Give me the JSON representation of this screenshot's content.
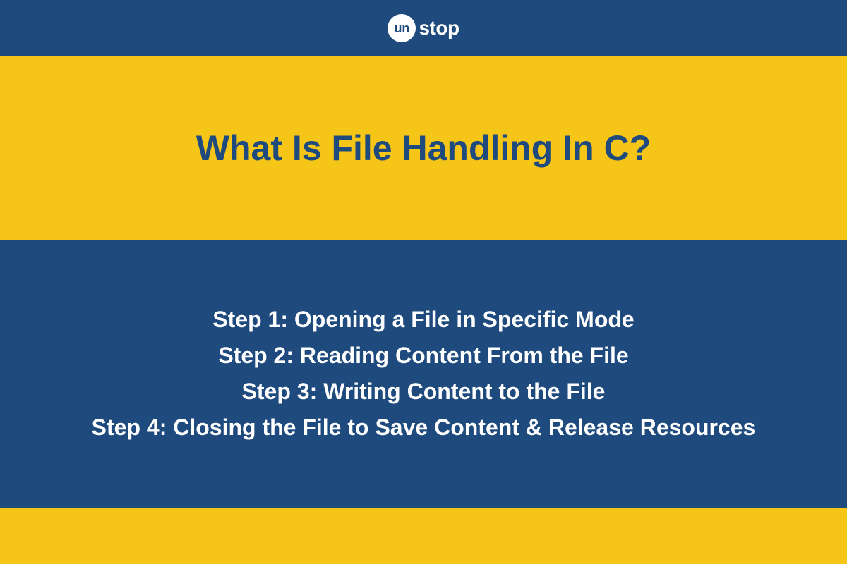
{
  "logo": {
    "circle_text": "un",
    "text": "stop"
  },
  "title": "What Is File Handling In C?",
  "steps": [
    "Step 1: Opening a File in Specific Mode",
    "Step 2: Reading Content From the File",
    "Step 3: Writing Content to the File",
    "Step 4: Closing the File to Save Content & Release Resources"
  ]
}
